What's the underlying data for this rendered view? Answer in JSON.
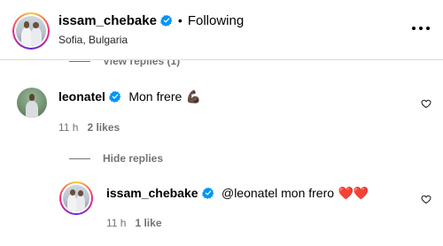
{
  "header": {
    "username": "issam_chebake",
    "separator": "•",
    "follow_status": "Following",
    "location": "Sofia, Bulgaria"
  },
  "thread": {
    "view_replies": "View replies (1)",
    "hide_replies": "Hide replies"
  },
  "comments": [
    {
      "username": "leonatel",
      "text": "Mon frere",
      "emoji": "💪🏿",
      "time": "11 h",
      "likes": "2 likes"
    },
    {
      "username": "issam_chebake",
      "text": "@leonatel mon frero",
      "emoji": "❤️❤️",
      "time": "11 h",
      "likes": "1 like"
    }
  ],
  "icons": {
    "verified": "verified-badge-icon",
    "more": "more-options-icon",
    "like": "heart-outline-icon"
  },
  "colors": {
    "verified_blue": "#0095f6",
    "muted_text": "#737373",
    "divider": "#dbdbdb"
  }
}
